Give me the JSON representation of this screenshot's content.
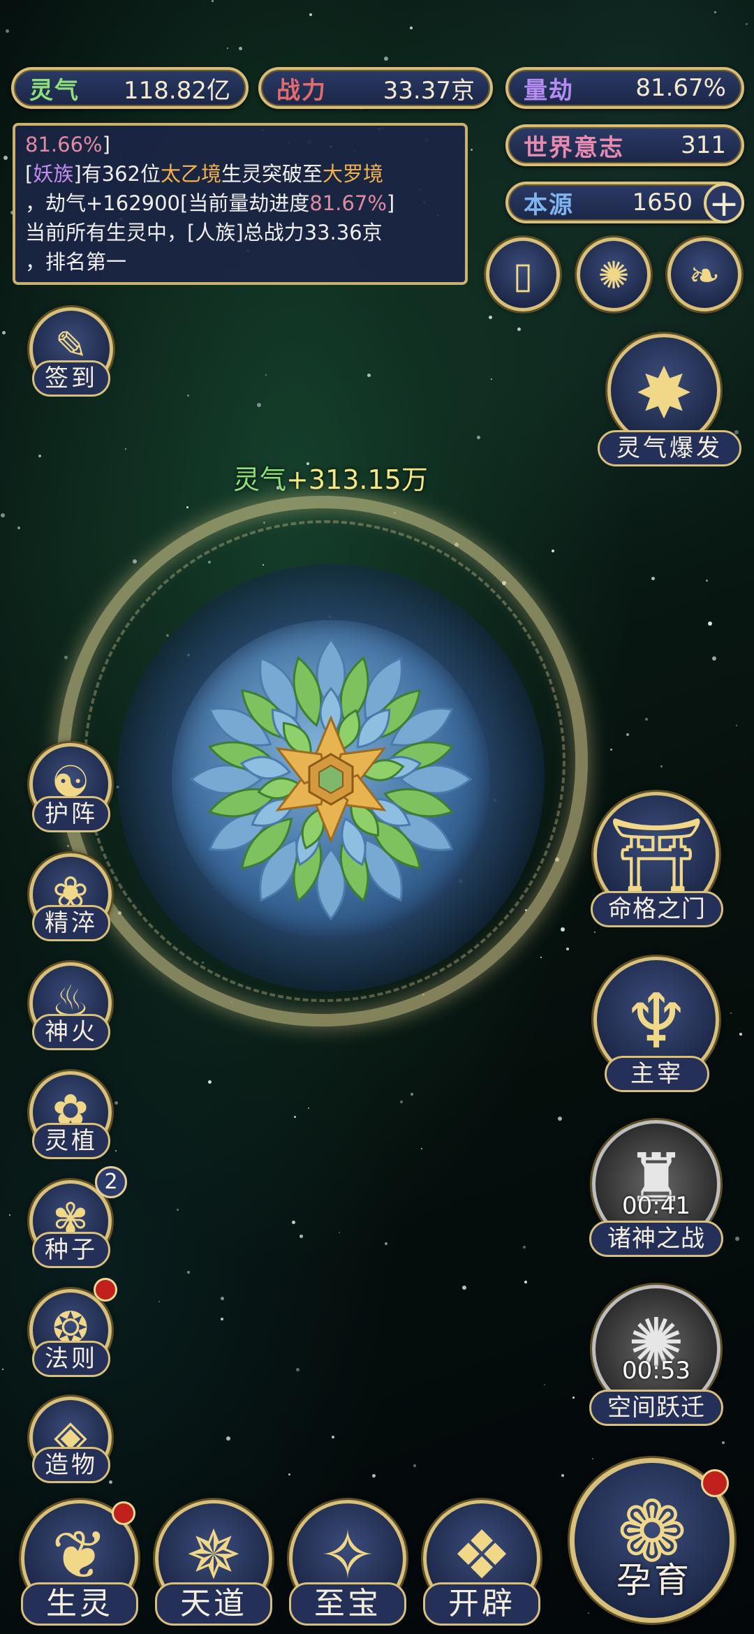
{
  "resources": {
    "lingqi": {
      "label": "灵气",
      "value": "118.82亿",
      "color": "#8ee07a"
    },
    "zhanli": {
      "label": "战力",
      "value": "33.37京",
      "color": "#e36b6b"
    },
    "liangjie": {
      "label": "量劫",
      "value": "81.67%",
      "color": "#b48cf2"
    },
    "shijie": {
      "label": "世界意志",
      "value": "311",
      "color": "#e88bb0"
    },
    "benyuan": {
      "label": "本源",
      "value": "1650",
      "color": "#7fb6f0"
    }
  },
  "log": {
    "line0": "81.66%",
    "line1_a": "[",
    "line1_race": "妖族",
    "line1_b": "]有362位",
    "line1_realm1": "太乙境",
    "line1_c": "生灵突破至",
    "line1_realm2": "大罗境",
    "line2_a": "，劫气+162900[当前量劫进度",
    "line2_pct": "81.67%",
    "line2_b": "]",
    "line3": "当前所有生灵中，[人族]总战力33.36京",
    "line4": "，排名第一"
  },
  "float_gain": {
    "label": "灵气",
    "value": "+313.15万"
  },
  "buttons": {
    "qiandao": "签到",
    "burst": "灵气爆发",
    "huzhen": "护阵",
    "jingcui": "精淬",
    "shenhuo": "神火",
    "lingzhi": "灵植",
    "zhongzi": "种子",
    "zhongzi_badge": "2",
    "faze": "法则",
    "zaowu": "造物",
    "mingge": "命格之门",
    "zhuzai": "主宰",
    "zhushen": "诸神之战",
    "zhushen_timer": "00:41",
    "kongjian": "空间跃迁",
    "kongjian_timer": "00:53"
  },
  "nav": {
    "shengling": "生灵",
    "tiandao": "天道",
    "zhibao": "至宝",
    "kaipi": "开辟",
    "yunyu": "孕育"
  }
}
